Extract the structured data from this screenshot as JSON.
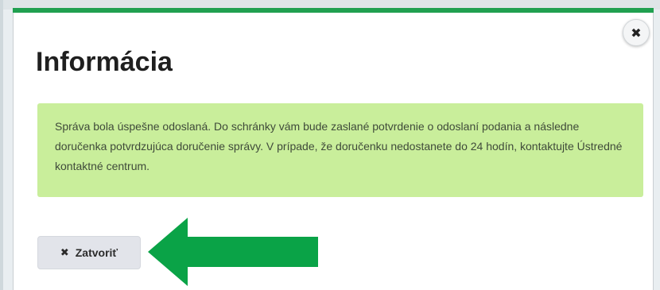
{
  "dialog": {
    "title": "Informácia",
    "close_icon_glyph": "✖",
    "message": "Správa bola úspešne odoslaná. Do schránky vám bude zaslané potvrdenie o odoslaní podania a následne doručenka potvrdzujúca doručenie správy. V prípade, že doručenku nedostanete do 24 hodín, kontaktujte Ústredné kontaktné centrum.",
    "close_button": {
      "icon": "✖",
      "label": "Zatvoriť"
    }
  },
  "annotation": {
    "arrow_color": "#0aa347",
    "arrow_direction": "left"
  },
  "colors": {
    "accent_top_bar": "#20a050",
    "alert_background": "#c9ee9b"
  }
}
